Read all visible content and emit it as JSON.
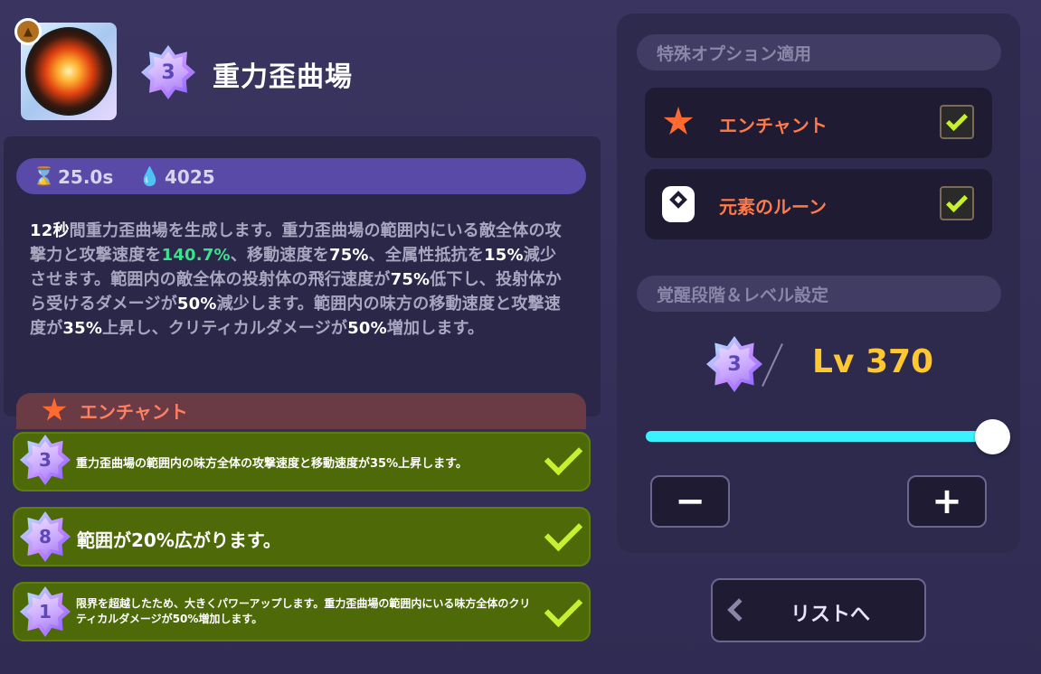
{
  "skill": {
    "name": "重力歪曲場",
    "grade": "3",
    "cooldown": "25.0s",
    "cost": "4025",
    "description": [
      {
        "t": "12秒",
        "s": "b"
      },
      {
        "t": "間重力歪曲場を生成します。重力歪曲場の範囲内にいる敵全体の攻撃力と攻撃速度を",
        "s": ""
      },
      {
        "t": "140.7%",
        "s": "green"
      },
      {
        "t": "、移動速度を",
        "s": ""
      },
      {
        "t": "75%",
        "s": "b"
      },
      {
        "t": "、全属性抵抗を",
        "s": ""
      },
      {
        "t": "15%",
        "s": "b"
      },
      {
        "t": "減少させます。範囲内の敵全体の投射体の飛行速度が",
        "s": ""
      },
      {
        "t": "75%",
        "s": "b"
      },
      {
        "t": "低下し、投射体から受けるダメージが",
        "s": ""
      },
      {
        "t": "50%",
        "s": "b"
      },
      {
        "t": "減少します。範囲内の味方の移動速度と攻撃速度が",
        "s": ""
      },
      {
        "t": "35%",
        "s": "b"
      },
      {
        "t": "上昇し、クリティカルダメージが",
        "s": ""
      },
      {
        "t": "50%",
        "s": "b"
      },
      {
        "t": "増加します。",
        "s": ""
      }
    ],
    "enchant_section_label": "エンチャント"
  },
  "effects": [
    {
      "grade": "3",
      "text": "重力歪曲場の範囲内の味方全体の攻撃速度と移動速度が35%上昇します。"
    },
    {
      "grade": "8",
      "text": "範囲が20%広がります。"
    },
    {
      "grade": "1",
      "text": "限界を超越したため、大きくパワーアップします。重力歪曲場の範囲内にいる味方全体のクリティカルダメージが50%増加します。"
    }
  ],
  "options": {
    "header": "特殊オプション適用",
    "items": [
      {
        "label": "エンチャント",
        "checked": true,
        "icon": "star-icon"
      },
      {
        "label": "元素のルーン",
        "checked": true,
        "icon": "rune-icon"
      }
    ]
  },
  "level_settings": {
    "header": "覚醒段階＆レベル設定",
    "grade": "3",
    "level": "Lv 370",
    "slider_fraction": 1.0,
    "minus_label": "−",
    "plus_label": "+"
  },
  "list_button": {
    "label": "リストへ"
  },
  "colors": {
    "accent_cyan": "#3af2ff",
    "level_gold": "#ffc830",
    "effect_green": "#4e6a08",
    "option_orange": "#ff7a4a"
  }
}
